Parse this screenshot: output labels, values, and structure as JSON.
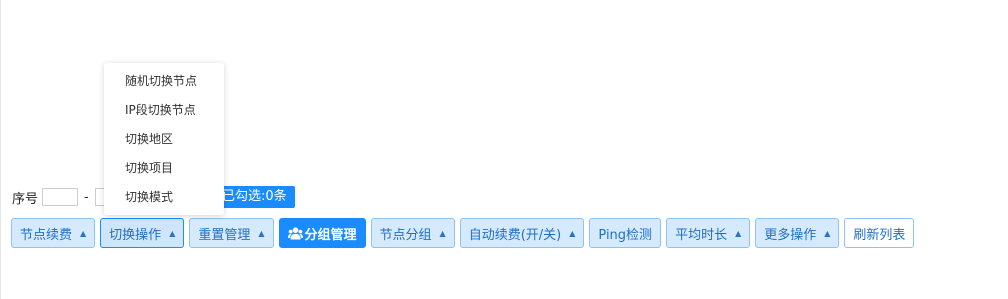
{
  "selection": {
    "index_label": "序号",
    "dash": "-",
    "checked_text": "已勾选:0条"
  },
  "dropdown": {
    "items": [
      "随机切换节点",
      "IP段切换节点",
      "切换地区",
      "切换项目",
      "切换模式"
    ]
  },
  "toolbar": {
    "buttons": [
      "节点续费",
      "切换操作",
      "重置管理",
      "分组管理",
      "节点分组",
      "自动续费(开/关)",
      "Ping检测",
      "平均时长",
      "更多操作",
      "刷新列表"
    ]
  },
  "icons": {
    "caret": "caret-up-icon",
    "group": "users-icon"
  },
  "colors": {
    "primary": "#1a8cff",
    "button_bg": "#d6eaff",
    "button_border": "#8cc3f5",
    "button_text": "#1e6fc7"
  }
}
